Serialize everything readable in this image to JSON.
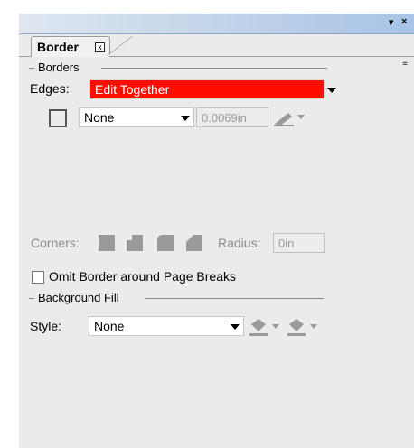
{
  "window": {
    "menu_glyph": "▾",
    "close_glyph": "×"
  },
  "tab": {
    "title": "Border",
    "close_glyph": "x",
    "panel_menu_glyph": "≡"
  },
  "borders": {
    "section_label": "Borders",
    "edges_label": "Edges:",
    "edges_value": "Edit Together",
    "line_style": "None",
    "width_value": "0.0069in",
    "corners_label": "Corners:",
    "radius_label": "Radius:",
    "radius_value": "0in",
    "omit_label": "Omit Border around Page Breaks",
    "omit_checked": false
  },
  "background": {
    "section_label": "Background Fill",
    "style_label": "Style:",
    "style_value": "None"
  },
  "colors": {
    "edges_highlight": "#ff0d00",
    "titlebar_gradient_end": "#a8c3e6",
    "panel_bg": "#ebebeb"
  },
  "icons": {
    "line_color": "pen-icon",
    "corners": [
      "corner-square-icon",
      "corner-notch-icon",
      "corner-rounded-icon",
      "corner-bevel-icon"
    ],
    "fill_color": "paint-bucket-icon",
    "fill_pattern": "paint-bucket-pattern-icon"
  }
}
